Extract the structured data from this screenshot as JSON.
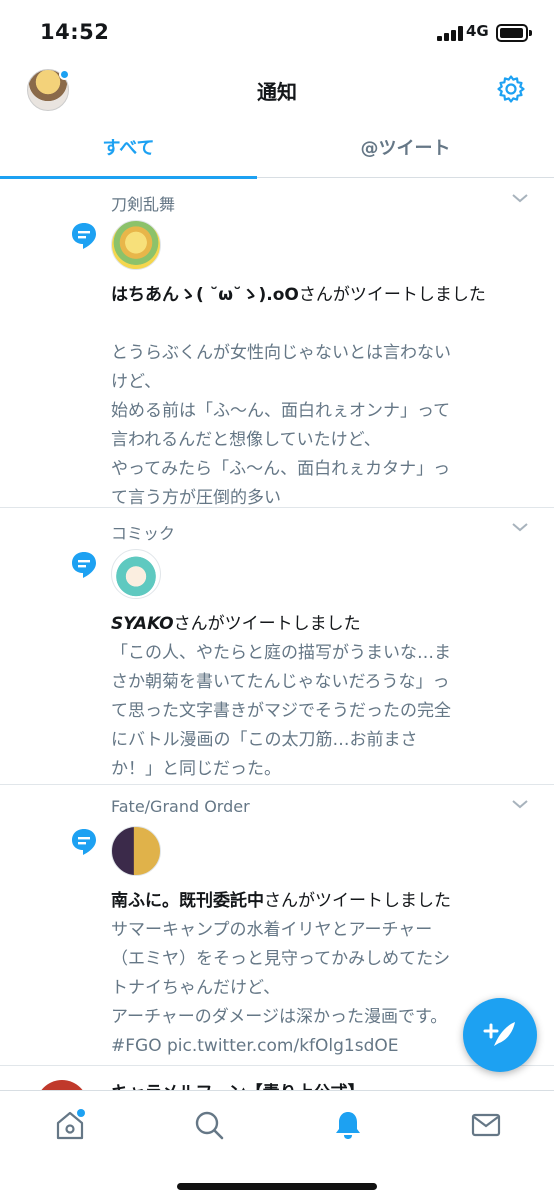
{
  "status_bar": {
    "time": "14:52",
    "network": "4G"
  },
  "header": {
    "title": "通知"
  },
  "tabs": [
    {
      "label": "すべて"
    },
    {
      "label": "@ツイート"
    }
  ],
  "notifications": [
    {
      "source": "刀剣乱舞",
      "user": "はちあんゝ( ˘ω˘ゝ).oO",
      "action": "さんがツイートしました",
      "body": "とうらぶくんが女性向じゃないとは言わない\nけど、\n始める前は「ふ〜ん、面白れぇオンナ」って\n言われるんだと想像していたけど、\nやってみたら「ふ〜ん、面白れぇカタナ」っ\nて言う方が圧倒的多い"
    },
    {
      "source": "コミック",
      "user": "SYAKO",
      "action": "さんがツイートしました",
      "body": "「この人、やたらと庭の描写がうまいな…ま\nさか朝菊を書いてたんじゃないだろうな」っ\nて思った文字書きがマジでそうだったの完全\nにバトル漫画の「この太刀筋…お前まさ\nか！」と同じだった。"
    },
    {
      "source": "Fate/Grand Order",
      "user": "南ふに。既刊委託中",
      "action": "さんがツイートしました",
      "body": "サマーキャンプの水着イリヤとアーチャー\n（エミヤ）をそっと見守ってかみしめてたシ\nトナイちゃんだけど、\nアーチャーのダメージは深かった漫画です。\n#FGO pic.twitter.com/kfOlg1sdOE"
    }
  ],
  "peek_item": {
    "text": "キャラメルフーン【青り上公式】"
  },
  "colors": {
    "accent": "#1da1f2",
    "secondary_text": "#657786"
  }
}
